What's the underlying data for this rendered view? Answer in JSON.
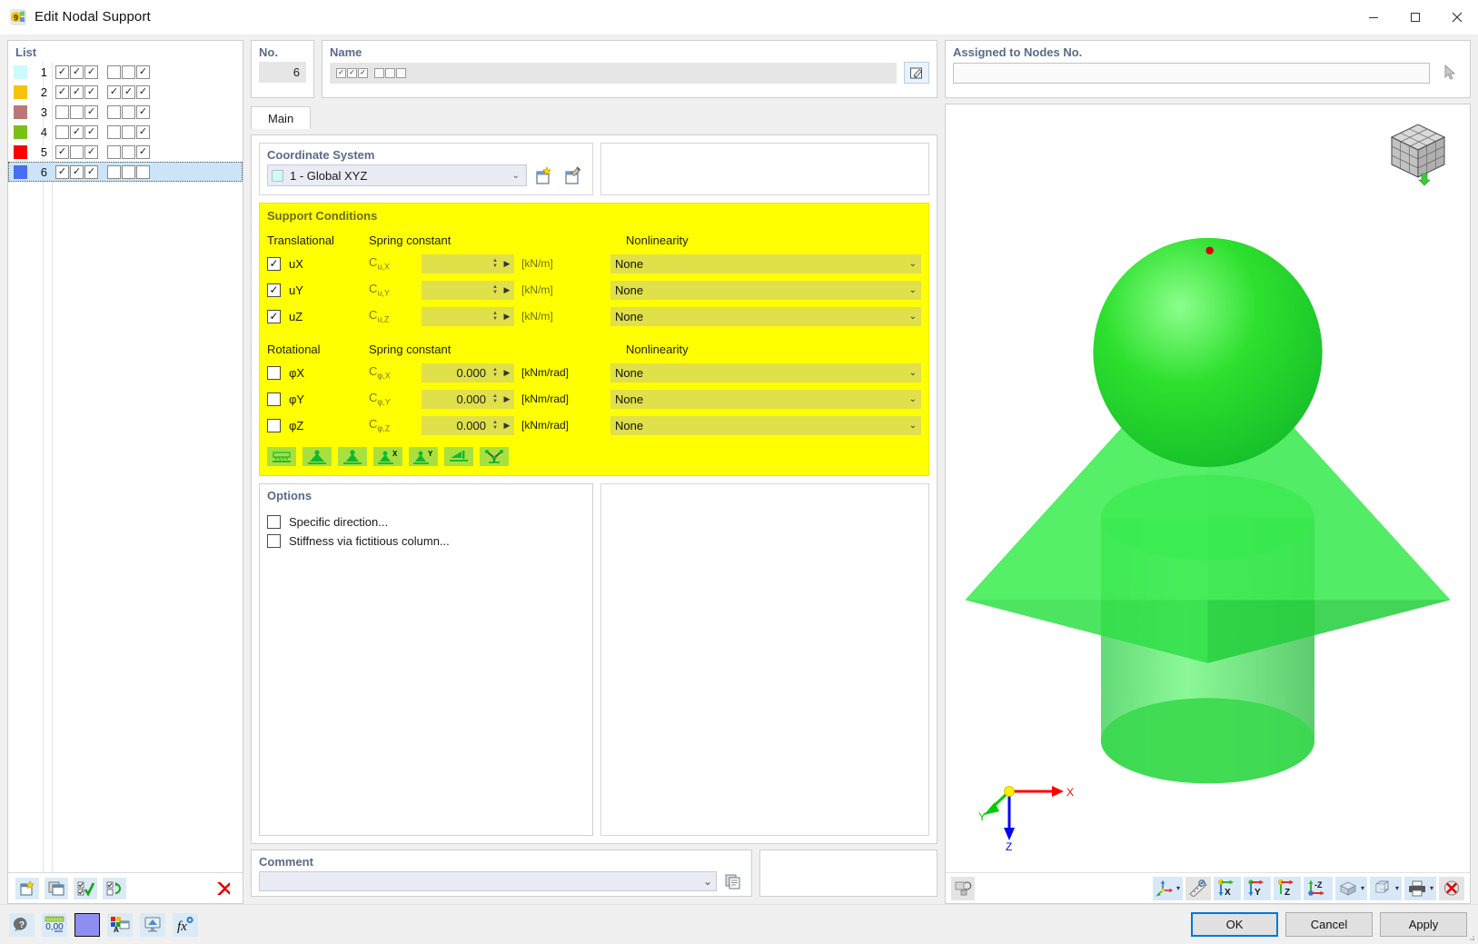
{
  "window": {
    "title": "Edit Nodal Support",
    "app_icon": "rfem-logo-icon",
    "minimize": "–",
    "maximize": "▢",
    "close": "✕"
  },
  "list": {
    "title": "List",
    "rows": [
      {
        "num": "1",
        "color": "#ccfbfb",
        "group1": [
          true,
          true,
          true
        ],
        "group2": [
          false,
          false,
          true
        ],
        "selected": false
      },
      {
        "num": "2",
        "color": "#f5c40a",
        "group1": [
          true,
          true,
          true
        ],
        "group2": [
          true,
          true,
          true
        ],
        "selected": false
      },
      {
        "num": "3",
        "color": "#b97878",
        "group1": [
          false,
          false,
          true
        ],
        "group2": [
          false,
          false,
          true
        ],
        "selected": false
      },
      {
        "num": "4",
        "color": "#7ac018",
        "group1": [
          false,
          true,
          true
        ],
        "group2": [
          false,
          false,
          true
        ],
        "selected": false
      },
      {
        "num": "5",
        "color": "#fc0000",
        "group1": [
          true,
          false,
          true
        ],
        "group2": [
          false,
          false,
          true
        ],
        "selected": false
      },
      {
        "num": "6",
        "color": "#4a6ef0",
        "group1": [
          true,
          true,
          true
        ],
        "group2": [
          false,
          false,
          false
        ],
        "selected": true
      }
    ],
    "toolbar": [
      {
        "name": "new-item-button",
        "icon": "new-window-star-icon"
      },
      {
        "name": "copy-item-button",
        "icon": "copy-window-icon"
      },
      {
        "name": "select-all-button",
        "icon": "checkmark-list-icon"
      },
      {
        "name": "refresh-selection-button",
        "icon": "checkbox-refresh-icon"
      },
      {
        "name": "delete-item-button",
        "icon": "red-x-icon"
      }
    ]
  },
  "no_field": {
    "title": "No.",
    "value": "6"
  },
  "name_field": {
    "title": "Name",
    "glyph_group1": [
      true,
      true,
      true
    ],
    "glyph_group2": [
      false,
      false,
      false
    ],
    "edit_button_icon": "edit-pencil-icon"
  },
  "assigned_nodes": {
    "title": "Assigned to Nodes No.",
    "value": "",
    "pick_button_icon": "pick-cursor-icon"
  },
  "tabs": [
    {
      "label": "Main",
      "active": true
    }
  ],
  "coordinate_system": {
    "title": "Coordinate System",
    "selected": "1 - Global XYZ",
    "swatch": "#ccfbfb",
    "chevron": "⌄",
    "new_button_icon": "new-coordinate-system-icon",
    "edit_button_icon": "edit-coordinate-system-icon"
  },
  "support_conditions": {
    "title": "Support Conditions",
    "headers": {
      "translational": "Translational",
      "rotational": "Rotational",
      "spring_constant": "Spring constant",
      "nonlinearity": "Nonlinearity"
    },
    "translational": [
      {
        "label": "uX",
        "checked": true,
        "symbol_main": "C",
        "symbol_sub": "u,X",
        "value": "",
        "unit": "[kN/m]",
        "nonlinearity": "None"
      },
      {
        "label": "uY",
        "checked": true,
        "symbol_main": "C",
        "symbol_sub": "u,Y",
        "value": "",
        "unit": "[kN/m]",
        "nonlinearity": "None"
      },
      {
        "label": "uZ",
        "checked": true,
        "symbol_main": "C",
        "symbol_sub": "u,Z",
        "value": "",
        "unit": "[kN/m]",
        "nonlinearity": "None"
      }
    ],
    "rotational": [
      {
        "label": "φX",
        "checked": false,
        "symbol_main": "C",
        "symbol_sub": "φ,X",
        "value": "0.000",
        "unit": "[kNm/rad]",
        "nonlinearity": "None"
      },
      {
        "label": "φY",
        "checked": false,
        "symbol_main": "C",
        "symbol_sub": "φ,Y",
        "value": "0.000",
        "unit": "[kNm/rad]",
        "nonlinearity": "None"
      },
      {
        "label": "φZ",
        "checked": false,
        "symbol_main": "C",
        "symbol_sub": "φ,Z",
        "value": "0.000",
        "unit": "[kNm/rad]",
        "nonlinearity": "None"
      }
    ],
    "preset_buttons": [
      {
        "name": "support-preset-hinged-line",
        "icon": "hatched-line-support-icon"
      },
      {
        "name": "support-preset-fixed",
        "icon": "cone-support-icon"
      },
      {
        "name": "support-preset-pinned",
        "icon": "cone-support-base-icon"
      },
      {
        "name": "support-preset-x",
        "icon": "cone-support-x-icon",
        "badge": "X"
      },
      {
        "name": "support-preset-y",
        "icon": "cone-support-y-icon",
        "badge": "Y"
      },
      {
        "name": "support-preset-slide",
        "icon": "slide-support-icon"
      },
      {
        "name": "support-preset-free",
        "icon": "scissor-support-icon"
      }
    ],
    "accent": "#ffff00",
    "field_color": "#e0e04a"
  },
  "options": {
    "title": "Options",
    "items": [
      {
        "label": "Specific direction...",
        "checked": false
      },
      {
        "label": "Stiffness via fictitious column...",
        "checked": false
      }
    ]
  },
  "comment": {
    "title": "Comment",
    "value": "",
    "chevron": "⌄",
    "browse_button_icon": "comment-library-icon"
  },
  "viewport": {
    "nav_cube_icon": "navigation-cube-icon",
    "axes": {
      "x": "X",
      "y": "Y",
      "z": "Z",
      "x_color": "#ff0000",
      "y_color": "#00cc00",
      "z_color": "#0000ff",
      "origin_color": "#ffee00"
    },
    "model_color": "#22dd44",
    "node_marker_color": "#dd0000",
    "toolbar": [
      {
        "name": "view-render-toggle-button",
        "icon": "render-swap-icon",
        "style": "plain"
      },
      {
        "name": "view-axes-button",
        "icon": "axes-triad-icon",
        "caret": "▾"
      },
      {
        "name": "view-measure-button",
        "icon": "ruler-eye-icon"
      },
      {
        "name": "view-direction-x-button",
        "icon": "axis-x-icon",
        "badge": "X"
      },
      {
        "name": "view-direction-y-button",
        "icon": "axis-y-icon",
        "badge": "Y"
      },
      {
        "name": "view-direction-z-button",
        "icon": "axis-z-icon",
        "badge": "Z"
      },
      {
        "name": "view-direction-minus-z-button",
        "icon": "axis-minus-z-icon",
        "badge": "Z"
      },
      {
        "name": "view-shading-button",
        "icon": "shaded-blocks-icon",
        "caret": "▾"
      },
      {
        "name": "view-wireframe-button",
        "icon": "wireframe-cube-icon",
        "caret": "▾"
      },
      {
        "name": "view-print-button",
        "icon": "printer-icon",
        "caret": "▾"
      },
      {
        "name": "view-close-button",
        "icon": "red-x-circle-icon"
      }
    ]
  },
  "footer": {
    "tools": [
      {
        "name": "help-button",
        "icon": "question-balloon-icon"
      },
      {
        "name": "decimal-places-button",
        "icon": "decimal-ruler-icon",
        "label": "0,00"
      },
      {
        "name": "color-swatch-button",
        "icon": "color-swatch-icon",
        "color": "#8e8ef0"
      },
      {
        "name": "display-properties-button",
        "icon": "palette-text-icon"
      },
      {
        "name": "visibility-button",
        "icon": "monitor-shape-icon"
      },
      {
        "name": "formula-button",
        "icon": "fx-eye-icon",
        "label": "fx"
      }
    ],
    "buttons": [
      {
        "label": "OK",
        "primary": true,
        "name": "ok-button"
      },
      {
        "label": "Cancel",
        "primary": false,
        "name": "cancel-button"
      },
      {
        "label": "Apply",
        "primary": false,
        "name": "apply-button"
      }
    ]
  }
}
